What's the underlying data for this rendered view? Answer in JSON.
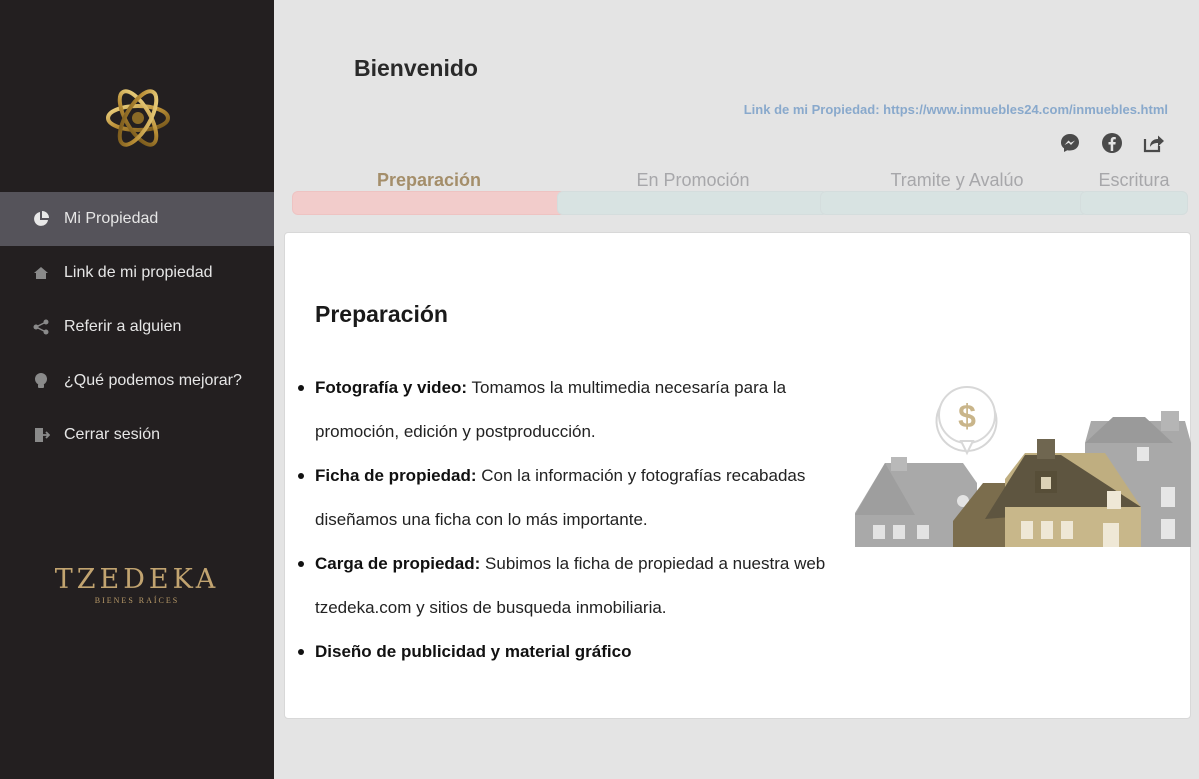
{
  "sidebar": {
    "items": [
      {
        "label": "Mi Propiedad",
        "icon": "pie-chart-icon",
        "active": true
      },
      {
        "label": "Link de mi propiedad",
        "icon": "home-icon",
        "active": false
      },
      {
        "label": "Referir a alguien",
        "icon": "share-icon",
        "active": false
      },
      {
        "label": "¿Qué podemos mejorar?",
        "icon": "lightbulb-icon",
        "active": false
      },
      {
        "label": "Cerrar sesión",
        "icon": "logout-icon",
        "active": false
      }
    ],
    "brand_name": "TZEDEKA",
    "brand_sub": "BIENES RAÍCES"
  },
  "header": {
    "title": "Bienvenido",
    "link_label": "Link de mi Propiedad: https://www.inmuebles24.com/inmuebles.html",
    "share_icons": [
      "messenger-icon",
      "facebook-icon",
      "share-external-icon"
    ]
  },
  "steps": [
    {
      "label": "Preparación",
      "active": true
    },
    {
      "label": "En Promoción",
      "active": false
    },
    {
      "label": "Tramite y Avalúo",
      "active": false
    },
    {
      "label": "Escritura",
      "active": false
    }
  ],
  "card": {
    "title": "Preparación",
    "items": [
      {
        "bold": "Fotografía y video:",
        "text": " Tomamos la multimedia necesaría para la promoción, edición y postproducción."
      },
      {
        "bold": "Ficha de propiedad:",
        "text": " Con la información y fotografías recabadas diseñamos una ficha con lo más importante."
      },
      {
        "bold": "Carga de propiedad:",
        "text": " Subimos la ficha de propiedad a nuestra web tzedeka.com y sitios de busqueda inmobiliaria."
      },
      {
        "bold": "Diseño de publicidad y material gráfico",
        "text": ""
      }
    ],
    "illustration": "houses-dollar-illustration"
  },
  "colors": {
    "sidebar_bg": "#231f20",
    "active_nav_bg": "#55535a",
    "gold": "#c2a470",
    "link_blue": "#89a9cc",
    "active_step_bar": "#f2cccb",
    "inactive_step_bar": "#d8e3e2"
  }
}
